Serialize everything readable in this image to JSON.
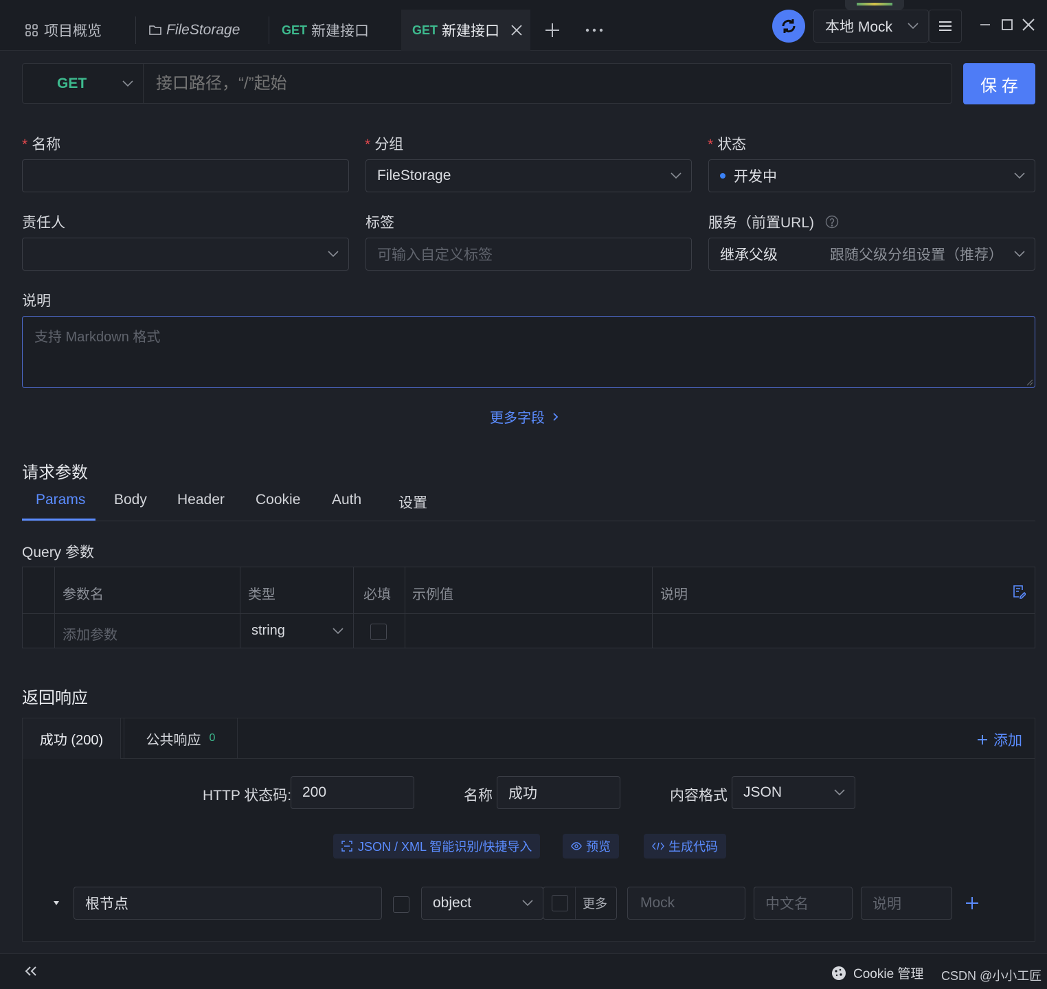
{
  "tabs": [
    {
      "label": "项目概览"
    },
    {
      "label": "FileStorage"
    },
    {
      "method": "GET",
      "label": "新建接口"
    },
    {
      "method": "GET",
      "label": "新建接口"
    }
  ],
  "topbar": {
    "env_label": "本地 Mock"
  },
  "request": {
    "method": "GET",
    "path_placeholder": "接口路径，“/”起始",
    "save_label": "保 存"
  },
  "form": {
    "name_label": "名称",
    "name_value": "",
    "group_label": "分组",
    "group_value": "FileStorage",
    "status_label": "状态",
    "status_value": "开发中",
    "owner_label": "责任人",
    "owner_value": "",
    "tags_label": "标签",
    "tags_placeholder": "可输入自定义标签",
    "service_label": "服务（前置URL)",
    "service_value": "继承父级",
    "service_hint": "跟随父级分组设置（推荐）",
    "desc_label": "说明",
    "desc_placeholder": "支持 Markdown 格式",
    "more_fields": "更多字段"
  },
  "params": {
    "title": "请求参数",
    "tabs": [
      "Params",
      "Body",
      "Header",
      "Cookie",
      "Auth",
      "设置"
    ],
    "active_tab": "Params",
    "query_title": "Query 参数",
    "columns": [
      "参数名",
      "类型",
      "必填",
      "示例值",
      "说明"
    ],
    "row": {
      "name_placeholder": "添加参数",
      "type": "string",
      "required": false
    }
  },
  "response": {
    "title": "返回响应",
    "tabs": [
      {
        "label": "成功 (200)"
      },
      {
        "label": "公共响应",
        "count": "0"
      }
    ],
    "add_label": "添加",
    "http_code_label": "HTTP 状态码:",
    "http_code": "200",
    "name_label": "名称",
    "name_value": "成功",
    "format_label": "内容格式",
    "format_value": "JSON",
    "actions": [
      "JSON / XML 智能识别/快捷导入",
      "预览",
      "生成代码"
    ],
    "root": {
      "name": "根节点",
      "type": "object",
      "more": "更多",
      "mock_placeholder": "Mock",
      "cn_placeholder": "中文名",
      "desc_placeholder": "说明"
    }
  },
  "footer": {
    "cookie_label": "Cookie 管理",
    "watermark": "CSDN @小小工匠"
  },
  "colors": {
    "accent": "#5b8cff",
    "get": "#3dba8e",
    "required": "#e5484d",
    "status_dot": "#3b82f6",
    "bg": "#1e2128"
  }
}
